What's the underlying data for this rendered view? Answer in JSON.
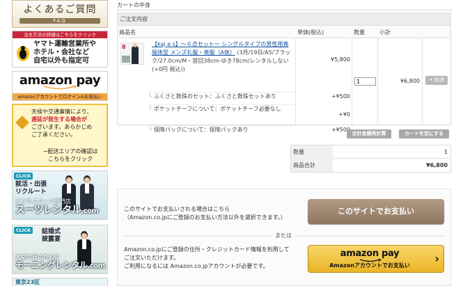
{
  "sidebar": {
    "faq": {
      "title": "よくあるご質問",
      "sub": "FAQ"
    },
    "yamato": {
      "header": "注文方法の詳細はこちらをクリック",
      "line1": "ヤマト運輸営業所や",
      "line2": "ホテル・会社など",
      "line3": "自宅以外も指定可"
    },
    "amazon_pay": {
      "logo": "amazon pay",
      "bar": "amazonアカウントでログイン&お支払い"
    },
    "notice": {
      "l1": "天候や交通事情により、",
      "l2": "遅延が発生する場合が",
      "l3": "ございます。あらかじめ",
      "l4": "ご了承ください。",
      "link1": "→配送エリアの確認は",
      "link2": "こちらをクリック"
    },
    "suit": {
      "badge": "CLICK",
      "l1": "就活・出張",
      "l2": "リクルート",
      "brand": "ビジネススーツ専門店",
      "big": "スーツレンタル",
      "com": ".com"
    },
    "morning": {
      "badge": "CLICK",
      "l1": "結婚式",
      "l2": "披露宴",
      "sub": "大切な日のために",
      "big": "モーニングレンタル",
      "com": ".com"
    },
    "tokyo": {
      "label": "東京23区"
    }
  },
  "cart": {
    "title": "カートの中身",
    "section": "ご注文内容",
    "columns": {
      "name": "商品名",
      "price": "単価(税込)",
      "qty": "数量",
      "subtotal": "小計"
    },
    "item": {
      "thumb_num": "8",
      "name_link": "【kaj a s】～６点セット～ シングルタイプの男性用喪服体型 メンズ礼服・喪服（A体）",
      "name_rest": "(3月/19日/A5/ブラック/27.0cm/M・首回38cm-ゆき78cm/レンタルしない(+0円 税込))",
      "price": "¥5,800",
      "qty": "1",
      "subtotal": "¥6,800",
      "delete": "✕ 取消"
    },
    "options": [
      {
        "label": "ふくさと数珠のセット：ふくさと数珠セットあり",
        "price": "+¥500"
      },
      {
        "label": "ポケットチーフについて：ポケットチーフ必要なし",
        "price": "+¥0"
      },
      {
        "label": "保障パックについて：保障パックあり",
        "price": "+¥500"
      }
    ],
    "recalc_button": "合計金額再計算",
    "empty_button": "カートを空にする",
    "totals": {
      "qty_label": "数量",
      "qty_value": "1",
      "sum_label": "商品合計",
      "sum_value": "¥6,800"
    }
  },
  "payment": {
    "site_text1": "このサイトでお支払いされる場合はこちら",
    "site_text2": "（Amazon.co.jpにご登録のお支払い方法以外を選択できます。）",
    "site_button": "このサイトでお支払い",
    "or": "または",
    "amazon_text1": "Amazon.co.jpにご登録の住所・クレジットカード情報を利用して",
    "amazon_text2": "ご注文いただけます。",
    "amazon_text3": "ご利用になるには Amazon.co.jpアカウントが必要です。",
    "amazon_logo": "amazon pay",
    "amazon_button_sub": "Amazonアカウントでお支払い",
    "amazon_chevron": "›"
  }
}
